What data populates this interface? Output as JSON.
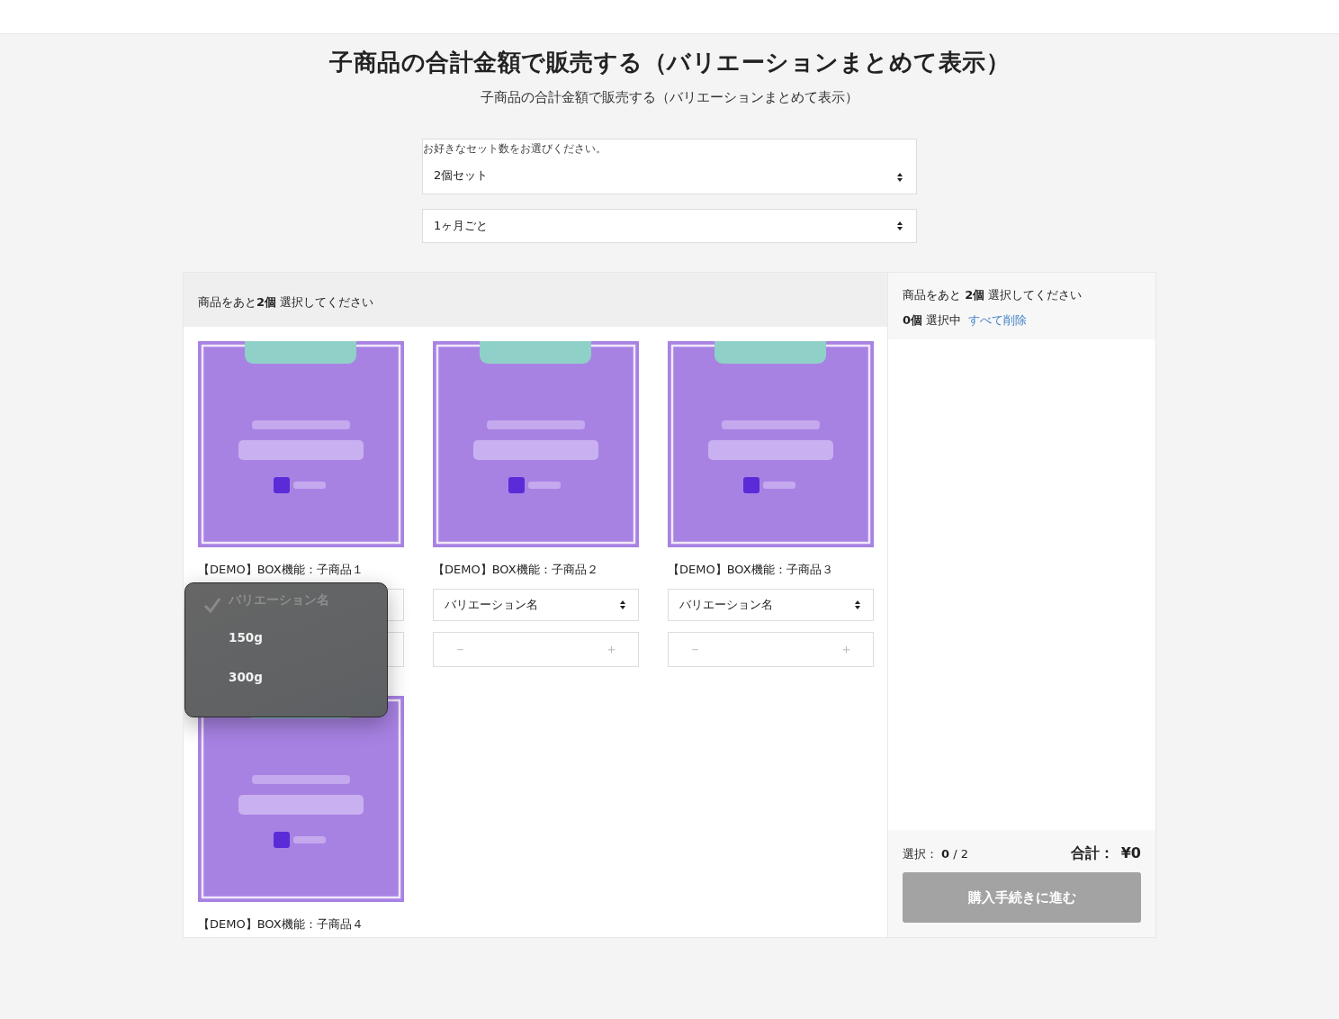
{
  "page": {
    "title": "子商品の合計金額で販売する（バリエーションまとめて表示）",
    "subtitle": "子商品の合計金額で販売する（バリエーションまとめて表示）"
  },
  "set_select": {
    "label": "お好きなセット数をお選びください。",
    "value": "2個セット"
  },
  "interval_select": {
    "value": "1ヶ月ごと"
  },
  "products_header": "商品をあと**2個** 選択してください",
  "products": [
    {
      "title": "【DEMO】BOX機能：子商品１",
      "dropdown": {
        "options": [
          {
            "label": "バリエーション名",
            "selected": true,
            "disabled": true
          },
          {
            "label": "150g",
            "selected": false,
            "disabled": false
          },
          {
            "label": "300g",
            "selected": false,
            "disabled": false
          }
        ]
      }
    },
    {
      "title": "【DEMO】BOX機能：子商品２",
      "variation": "バリエーション名",
      "minus": "－",
      "plus": "＋"
    },
    {
      "title": "【DEMO】BOX機能：子商品３",
      "variation": "バリエーション名",
      "minus": "－",
      "plus": "＋"
    },
    {
      "title": "【DEMO】BOX機能：子商品４"
    }
  ],
  "summary": {
    "remaining": "商品をあと **2個** 選択してください",
    "selected_count": "**0個** 選択中",
    "clear_link": "すべて削除",
    "selection_label": "選択：",
    "selection_value": "**0** / 2",
    "total_label": "合計：",
    "total_value": "¥0",
    "checkout_button": "購入手続きに進む",
    "checkout_disabled": true
  }
}
